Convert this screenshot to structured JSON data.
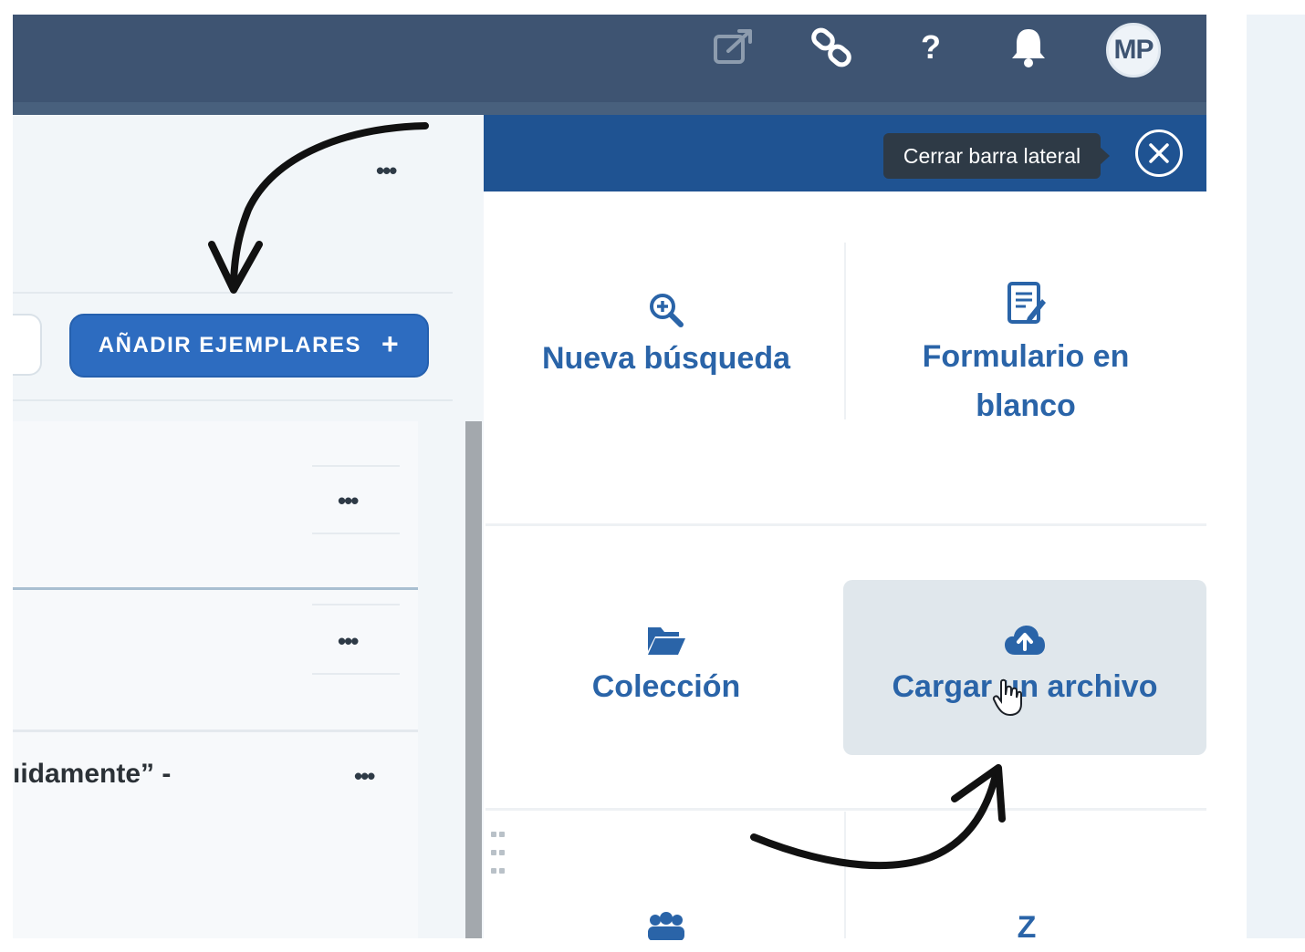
{
  "header": {
    "avatar_initials": "MP",
    "help_label": "?",
    "icons": [
      "external-link-icon",
      "link-icon",
      "help-icon",
      "bell-icon"
    ],
    "colors": {
      "bar": "#3e5472",
      "sidebar_header": "#1f5392",
      "accent": "#2d6cc0"
    }
  },
  "left": {
    "add_button_label": "AÑADIR EJEMPLARES",
    "add_button_icon": "plus-icon",
    "more_label": "•••",
    "row_text": "ıidamente” -"
  },
  "sidebar": {
    "tooltip": "Cerrar barra lateral",
    "close_icon": "close-icon",
    "tiles": [
      {
        "label": "Nueva búsqueda",
        "icon": "search-plus-icon"
      },
      {
        "label": "Formulario en blanco",
        "icon": "form-icon"
      },
      {
        "label": "Colección",
        "icon": "folder-open-icon"
      },
      {
        "label": "Cargar un archivo",
        "icon": "cloud-upload-icon"
      },
      {
        "label": "",
        "icon": "group-icon"
      },
      {
        "label": "Z",
        "icon": ""
      }
    ]
  }
}
